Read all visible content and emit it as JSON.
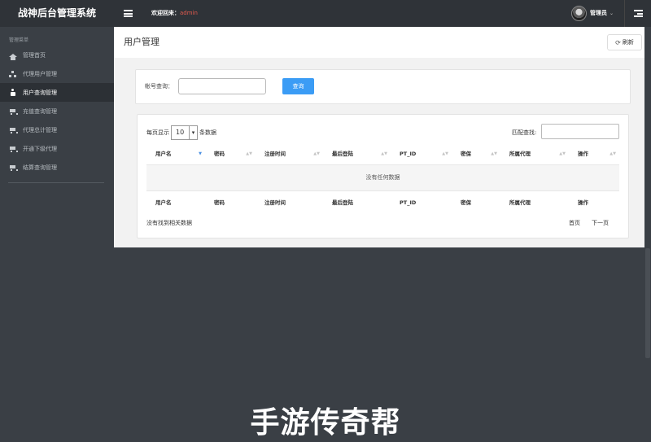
{
  "app": {
    "title": "战神后台管理系统"
  },
  "header": {
    "welcome_label": "欢迎回来：",
    "welcome_user": "admin",
    "admin_label": "管理员",
    "caret": "⌄"
  },
  "sidebar": {
    "heading": "管理菜单",
    "items": [
      {
        "label": "管理首页",
        "icon": "home-icon"
      },
      {
        "label": "代理用户管理",
        "icon": "sitemap-icon"
      },
      {
        "label": "用户查询管理",
        "icon": "user-icon",
        "active": true
      },
      {
        "label": "充值查询管理",
        "icon": "cart-icon"
      },
      {
        "label": "代理总计管理",
        "icon": "cart-icon"
      },
      {
        "label": "开通下级代理",
        "icon": "cart-icon"
      },
      {
        "label": "结算查询管理",
        "icon": "cart-icon"
      }
    ]
  },
  "page": {
    "title": "用户管理",
    "refresh_label": "刷新",
    "refresh_icon": "⟳"
  },
  "search": {
    "label": "帐号查询：",
    "input_value": "",
    "button_label": "查询"
  },
  "table": {
    "length_prefix": "每页显示",
    "length_value": "10",
    "length_suffix": "条数据",
    "filter_label": "匹配查找:",
    "filter_value": "",
    "columns": [
      "用户名",
      "密码",
      "注册时间",
      "最后登陆",
      "PT_ID",
      "密保",
      "所属代理",
      "操作"
    ],
    "empty_text": "没有任何数据",
    "info_text": "没有找到相关数据",
    "pager_first": "首页",
    "pager_next": "下一页"
  },
  "watermark": "手游传奇帮",
  "colors": {
    "accent": "#3b9cf5",
    "topbar": "#2f3338",
    "sidebar": "#3a3f45",
    "welcome_user": "#e05a4e"
  }
}
